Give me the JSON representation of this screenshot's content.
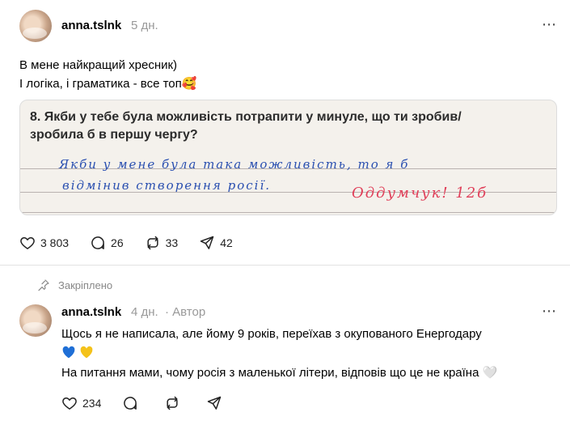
{
  "post": {
    "username": "anna.tslnk",
    "time": "5 дн.",
    "line1": "В мене найкращий хресник)",
    "line2": "І логіка, і граматика - все топ🥰",
    "image": {
      "question_line1": "8. Якби у тебе була можливість потрапити у минуле, що ти зробив/",
      "question_line2": "зробила б в першу чергу?",
      "answer_line1": "Якби у мене була така можливість, то я б",
      "answer_line2": "відмінив створення росії.",
      "teacher_note": "Оддумчук! 12б"
    },
    "stats": {
      "likes": "3 803",
      "comments": "26",
      "reposts": "33",
      "shares": "42"
    }
  },
  "pinned": {
    "label": "Закріплено"
  },
  "reply": {
    "username": "anna.tslnk",
    "time": "4 дн.",
    "author_badge": "· Автор",
    "line1": "Щось я не написала, але йому 9 років, переїхав з окупованого Енергодару",
    "line3": "На питання мами, чому росія з маленької літери, відповів що це не країна 🤍",
    "stats": {
      "likes": "234"
    }
  },
  "icons": [
    "avatar",
    "more-icon",
    "heart-icon",
    "comment-icon",
    "repost-icon",
    "share-icon",
    "pin-icon",
    "blue-heart-icon",
    "yellow-heart-icon"
  ],
  "colors": {
    "meta_gray": "#999999",
    "ink_blue": "#2a4fb0",
    "teacher_red": "#e0405a",
    "divider": "#e2e2e2"
  }
}
